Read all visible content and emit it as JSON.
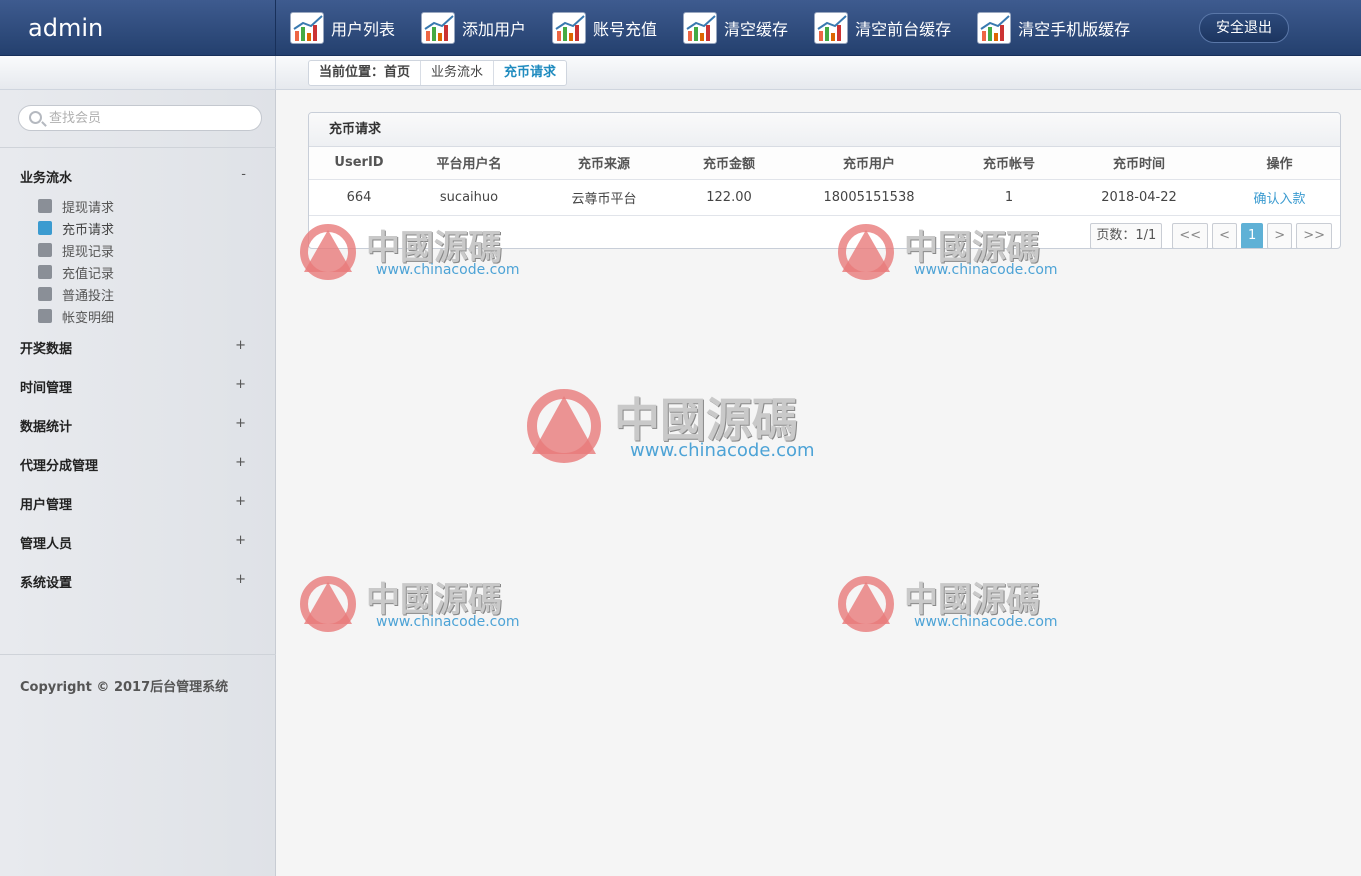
{
  "header": {
    "brand": "admin",
    "nav": [
      {
        "label": "用户列表"
      },
      {
        "label": "添加用户"
      },
      {
        "label": "账号充值"
      },
      {
        "label": "清空缓存"
      },
      {
        "label": "清空前台缓存"
      },
      {
        "label": "清空手机版缓存"
      }
    ],
    "logout": "安全退出"
  },
  "breadcrumb": [
    "当前位置：首页",
    "业务流水",
    "充币请求"
  ],
  "sidebar": {
    "search_placeholder": "查找会员",
    "groups": [
      {
        "label": "业务流水",
        "toggle": "-",
        "items": [
          "提现请求",
          "充币请求",
          "提现记录",
          "充值记录",
          "普通投注",
          "帐变明细"
        ]
      },
      {
        "label": "开奖数据",
        "toggle": "+"
      },
      {
        "label": "时间管理",
        "toggle": "+"
      },
      {
        "label": "数据统计",
        "toggle": "+"
      },
      {
        "label": "代理分成管理",
        "toggle": "+"
      },
      {
        "label": "用户管理",
        "toggle": "+"
      },
      {
        "label": "管理人员",
        "toggle": "+"
      },
      {
        "label": "系统设置",
        "toggle": "+"
      }
    ],
    "copyright": "Copyright © 2017后台管理系统"
  },
  "panel": {
    "title": "充币请求",
    "columns": [
      "UserID",
      "平台用户名",
      "充币来源",
      "充币金额",
      "充币用户",
      "充币帐号",
      "充币时间",
      "操作"
    ],
    "rows": [
      [
        "664",
        "sucaihuo",
        "云尊币平台",
        "122.00",
        "18005151538",
        "1",
        "2018-04-22",
        "确认入款"
      ]
    ],
    "pager": {
      "info": "页数：1/1",
      "first": "<<",
      "prev": "<",
      "current": "1",
      "next": ">",
      "last": ">>"
    }
  },
  "watermark": {
    "cn": "中國源碼",
    "url": "www.chinacode.com"
  },
  "colors": {
    "topbar": "#2f4c7f",
    "accent": "#3b9bd0",
    "pager_active": "#5fb1d6"
  }
}
